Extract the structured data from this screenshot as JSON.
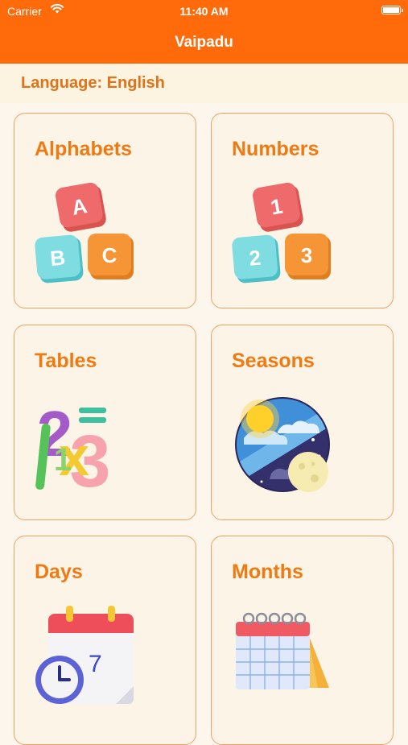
{
  "status_bar": {
    "carrier": "Carrier",
    "time": "11:40 AM"
  },
  "nav": {
    "title": "Vaipadu"
  },
  "language": {
    "label": "Language: English"
  },
  "cards": [
    {
      "title": "Alphabets",
      "icon": "abc-blocks-icon",
      "glyphs": [
        "A",
        "B",
        "C"
      ]
    },
    {
      "title": "Numbers",
      "icon": "number-blocks-icon",
      "glyphs": [
        "1",
        "2",
        "3"
      ]
    },
    {
      "title": "Tables",
      "icon": "math-tables-icon",
      "glyphs": [
        "2",
        "1",
        "x",
        "3"
      ]
    },
    {
      "title": "Seasons",
      "icon": "day-night-globe-icon"
    },
    {
      "title": "Days",
      "icon": "calendar-clock-icon",
      "glyphs": [
        "7"
      ]
    },
    {
      "title": "Months",
      "icon": "desk-calendar-icon"
    }
  ],
  "colors": {
    "accent": "#ff6a0a",
    "title_text": "#f07a12",
    "card_border": "#f4a15d",
    "card_bg": "#fdf4e8"
  }
}
